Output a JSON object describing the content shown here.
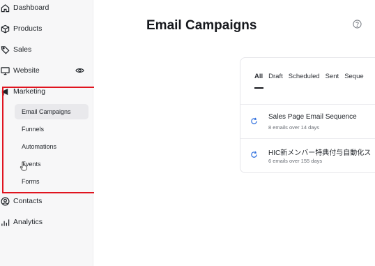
{
  "sidebar": {
    "items": [
      {
        "label": "Dashboard",
        "icon": "home-icon"
      },
      {
        "label": "Products",
        "icon": "box-icon"
      },
      {
        "label": "Sales",
        "icon": "tag-icon"
      },
      {
        "label": "Website",
        "icon": "monitor-icon"
      },
      {
        "label": "Marketing",
        "icon": "megaphone-icon"
      },
      {
        "label": "Contacts",
        "icon": "user-circle-icon"
      },
      {
        "label": "Analytics",
        "icon": "bar-chart-icon"
      }
    ],
    "marketing_sub": [
      {
        "label": "Email Campaigns",
        "active": true
      },
      {
        "label": "Funnels"
      },
      {
        "label": "Automations"
      },
      {
        "label": "Events"
      },
      {
        "label": "Forms"
      }
    ]
  },
  "main": {
    "title": "Email Campaigns",
    "tabs": [
      "All",
      "Draft",
      "Scheduled",
      "Sent",
      "Seque"
    ],
    "active_tab": "All",
    "campaigns": [
      {
        "name": "Sales Page Email Sequence",
        "meta": "8 emails over 14 days"
      },
      {
        "name": "HIC新メンバー特典付与自動化ス",
        "meta": "6 emails over 155 days"
      }
    ]
  },
  "colors": {
    "highlight": "#e0141f",
    "accent": "#2f6fde"
  }
}
